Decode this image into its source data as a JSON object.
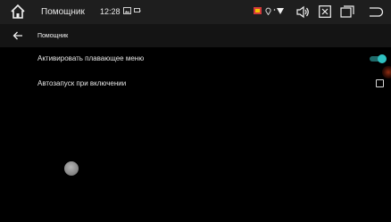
{
  "statusbar": {
    "title": "Помощник",
    "time": "12:28",
    "icons": [
      "home-icon",
      "image-icon",
      "cast-icon",
      "flag-icon",
      "location-icon",
      "wifi-icon",
      "volume-icon",
      "close-box-icon",
      "recent-apps-icon",
      "back-icon"
    ]
  },
  "appbar": {
    "title": "Помощник"
  },
  "settings": {
    "floating_menu_label": "Активировать плавающее меню",
    "floating_menu_enabled": true,
    "autostart_label": "Автозапуск при включении",
    "autostart_enabled": false
  },
  "colors": {
    "background": "#000000",
    "statusbar": "#1e1e1e",
    "appbar": "#141414",
    "accent": "#2fc1c1"
  }
}
